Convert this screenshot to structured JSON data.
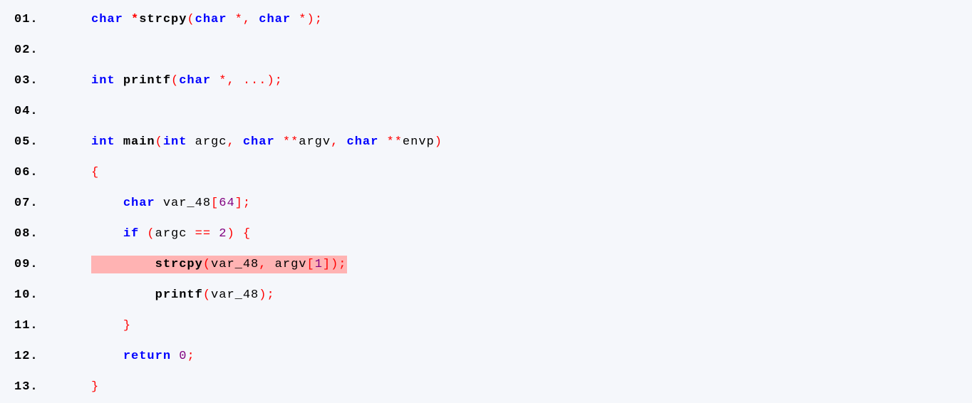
{
  "lines": [
    {
      "num": "01.",
      "indent": 0,
      "highlight": false,
      "tokens": [
        {
          "t": "char",
          "c": "kw"
        },
        {
          "t": " ",
          "c": "id"
        },
        {
          "t": "*",
          "c": "opb"
        },
        {
          "t": "strcpy",
          "c": "fn"
        },
        {
          "t": "(",
          "c": "op"
        },
        {
          "t": "char",
          "c": "kw"
        },
        {
          "t": " ",
          "c": "id"
        },
        {
          "t": "*",
          "c": "op"
        },
        {
          "t": ",",
          "c": "op"
        },
        {
          "t": " ",
          "c": "id"
        },
        {
          "t": "char",
          "c": "kw"
        },
        {
          "t": " ",
          "c": "id"
        },
        {
          "t": "*",
          "c": "op"
        },
        {
          "t": ")",
          "c": "op"
        },
        {
          "t": ";",
          "c": "op"
        }
      ]
    },
    {
      "num": "02.",
      "indent": 0,
      "highlight": false,
      "tokens": []
    },
    {
      "num": "03.",
      "indent": 0,
      "highlight": false,
      "tokens": [
        {
          "t": "int",
          "c": "kw"
        },
        {
          "t": " ",
          "c": "id"
        },
        {
          "t": "printf",
          "c": "fn"
        },
        {
          "t": "(",
          "c": "op"
        },
        {
          "t": "char",
          "c": "kw"
        },
        {
          "t": " ",
          "c": "id"
        },
        {
          "t": "*",
          "c": "op"
        },
        {
          "t": ",",
          "c": "op"
        },
        {
          "t": " ",
          "c": "id"
        },
        {
          "t": "...",
          "c": "op"
        },
        {
          "t": ")",
          "c": "op"
        },
        {
          "t": ";",
          "c": "op"
        }
      ]
    },
    {
      "num": "04.",
      "indent": 0,
      "highlight": false,
      "tokens": []
    },
    {
      "num": "05.",
      "indent": 0,
      "highlight": false,
      "tokens": [
        {
          "t": "int",
          "c": "kw"
        },
        {
          "t": " ",
          "c": "id"
        },
        {
          "t": "main",
          "c": "fn"
        },
        {
          "t": "(",
          "c": "op"
        },
        {
          "t": "int",
          "c": "kw"
        },
        {
          "t": " argc",
          "c": "id"
        },
        {
          "t": ",",
          "c": "op"
        },
        {
          "t": " ",
          "c": "id"
        },
        {
          "t": "char",
          "c": "kw"
        },
        {
          "t": " ",
          "c": "id"
        },
        {
          "t": "**",
          "c": "op"
        },
        {
          "t": "argv",
          "c": "id"
        },
        {
          "t": ",",
          "c": "op"
        },
        {
          "t": " ",
          "c": "id"
        },
        {
          "t": "char",
          "c": "kw"
        },
        {
          "t": " ",
          "c": "id"
        },
        {
          "t": "**",
          "c": "op"
        },
        {
          "t": "envp",
          "c": "id"
        },
        {
          "t": ")",
          "c": "op"
        }
      ]
    },
    {
      "num": "06.",
      "indent": 0,
      "highlight": false,
      "tokens": [
        {
          "t": "{",
          "c": "op"
        }
      ]
    },
    {
      "num": "07.",
      "indent": 1,
      "highlight": false,
      "tokens": [
        {
          "t": "char",
          "c": "kw"
        },
        {
          "t": " var_48",
          "c": "id"
        },
        {
          "t": "[",
          "c": "op"
        },
        {
          "t": "64",
          "c": "num"
        },
        {
          "t": "]",
          "c": "op"
        },
        {
          "t": ";",
          "c": "op"
        }
      ]
    },
    {
      "num": "08.",
      "indent": 1,
      "highlight": false,
      "tokens": [
        {
          "t": "if",
          "c": "kw"
        },
        {
          "t": " ",
          "c": "id"
        },
        {
          "t": "(",
          "c": "op"
        },
        {
          "t": "argc ",
          "c": "id"
        },
        {
          "t": "==",
          "c": "op"
        },
        {
          "t": " ",
          "c": "id"
        },
        {
          "t": "2",
          "c": "num"
        },
        {
          "t": ")",
          "c": "op"
        },
        {
          "t": " ",
          "c": "id"
        },
        {
          "t": "{",
          "c": "op"
        }
      ]
    },
    {
      "num": "09.",
      "indent": 2,
      "highlight": true,
      "tokens": [
        {
          "t": "strcpy",
          "c": "fn"
        },
        {
          "t": "(",
          "c": "op"
        },
        {
          "t": "var_48",
          "c": "id"
        },
        {
          "t": ",",
          "c": "op"
        },
        {
          "t": " argv",
          "c": "id"
        },
        {
          "t": "[",
          "c": "op"
        },
        {
          "t": "1",
          "c": "num"
        },
        {
          "t": "]",
          "c": "op"
        },
        {
          "t": ")",
          "c": "op"
        },
        {
          "t": ";",
          "c": "op"
        }
      ]
    },
    {
      "num": "10.",
      "indent": 2,
      "highlight": false,
      "tokens": [
        {
          "t": "printf",
          "c": "fn"
        },
        {
          "t": "(",
          "c": "op"
        },
        {
          "t": "var_48",
          "c": "id"
        },
        {
          "t": ")",
          "c": "op"
        },
        {
          "t": ";",
          "c": "op"
        }
      ]
    },
    {
      "num": "11.",
      "indent": 1,
      "highlight": false,
      "tokens": [
        {
          "t": "}",
          "c": "op"
        }
      ]
    },
    {
      "num": "12.",
      "indent": 1,
      "highlight": false,
      "tokens": [
        {
          "t": "return",
          "c": "kw"
        },
        {
          "t": " ",
          "c": "id"
        },
        {
          "t": "0",
          "c": "num"
        },
        {
          "t": ";",
          "c": "op"
        }
      ]
    },
    {
      "num": "13.",
      "indent": 0,
      "highlight": false,
      "tokens": [
        {
          "t": "}",
          "c": "op"
        }
      ]
    }
  ],
  "indent_unit": "    "
}
